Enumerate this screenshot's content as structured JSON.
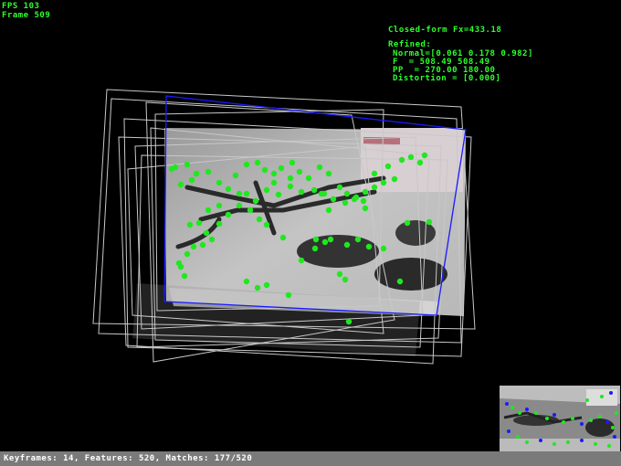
{
  "hud": {
    "fps": "FPS 103",
    "frame": "Frame 509",
    "closed_form": "Closed-form Fx=433.18",
    "refined_title": "Refined:",
    "normal": "Normal=[0.061 0.178 0.982]",
    "focal": "F  = 508.49 508.49",
    "pp": "PP  = 270.00 180.00",
    "distortion": "Distortion = [0.000]"
  },
  "status": {
    "text": "Keyframes: 14, Features: 520, Matches: 177/520"
  },
  "colors": {
    "hud_text": "#2dff2d",
    "feature_point": "#1fe81f",
    "plane_outline": "#1a1aff",
    "keyframe_outline": "#c8c8c8",
    "status_bg": "#7a7a7a"
  }
}
